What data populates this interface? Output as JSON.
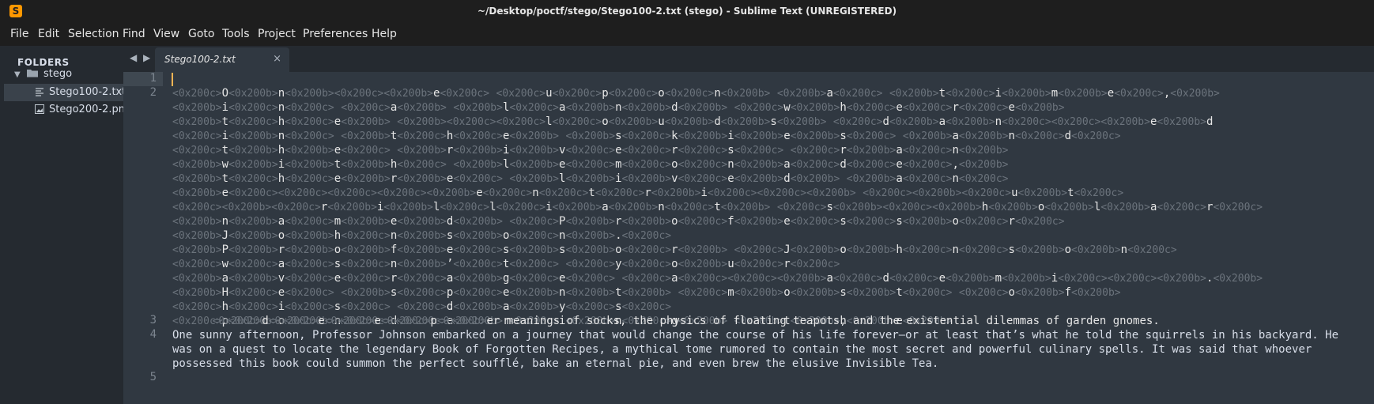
{
  "window": {
    "title": "~/Desktop/poctf/stego/Stego100-2.txt (stego) - Sublime Text (UNREGISTERED)",
    "app_icon": "S"
  },
  "menu": [
    "File",
    "Edit",
    "Selection",
    "Find",
    "View",
    "Goto",
    "Tools",
    "Project",
    "Preferences",
    "Help"
  ],
  "sidebar": {
    "header": "FOLDERS",
    "folder": "stego",
    "files": [
      "Stego100-2.txt",
      "Stego200-2.png"
    ]
  },
  "tab": {
    "label": "Stego100-2.txt",
    "close": "×"
  },
  "nav_arrows": "◀ ▶",
  "gutter": {
    "line_numbers": [
      "1",
      "2",
      "3",
      "4",
      "5"
    ]
  },
  "editor": {
    "zw_b": "<0x200b>",
    "zw_c": "<0x200c>",
    "hidden_rows": [
      "cOb|n|b|c|b|e|c| |c|u|c|p|c|o|c|n|b| |b|a|c| |b|t|c|i|b|m|b|e|c|,|b",
      "b|i|c|n|c| |c|a|b| |b|l|c|a|b|n|b|d|b| |c|w|b|h|c|e|c|r|c|e|b",
      "b|t|c|h|c|e|b| |b|c|c|l|c|o|b|u|b|d|b|s|b| |c|d|b|a|b|n|c|c|b|e|b|d",
      "c|i|b|n|c| |b|t|c|h|c|e|b| |b|s|c|k|b|i|b|e|b|s|c| |b|a|b|n|c|d|c",
      "c|t|b|h|b|e|c| |b|r|b|i|b|v|c|e|c|r|c|s|c| |c|r|b|a|c|n|b",
      "b|w|b|i|b|t|b|h|c| |b|l|b|e|c|m|c|o|c|n|b|a|c|d|c|e|c|,|b",
      "b|t|c|h|c|e|b|r|b|e|c| |b|l|b|i|b|v|c|e|b|d|b| |b|a|c|n|c",
      "b|e|c|c|c|c|b|e|c|n|c|t|c|r|b|i|c|c|b| |c|b|c|u|b|t|c",
      "c|b|c|r|b|i|b|l|c|l|c|i|b|a|b|n|c|t|b| |c|s|b|c|b|h|b|o|b|l|b|a|c|r|c",
      "b|n|b|a|c|m|b|e|b|d|b| |c|P|b|r|b|o|c|f|b|e|c|s|c|s|b|o|c|r|c",
      "b|J|b|o|b|h|c|n|b|s|b|o|c|n|b|.|c",
      "b|P|b|r|b|o|b|f|b|e|c|s|b|s|b|o|c|r|b| |c|J|b|o|b|h|c|n|c|s|b|o|b|n|c",
      "c|w|c|a|c|s|c|n|b|’|c|t|c| |c|y|c|o|b|u|c|r|c",
      "b|a|b|v|c|e|c|r|c|a|b|g|c|e|c| |c|a|c|c|b|a|c|d|c|e|b|m|b|i|c|c|b|.|b",
      "b|H|c|e|c| |b|s|c|p|c|e|b|n|b|t|b| |c|m|b|o|b|s|b|t|c| |c|o|b|f|b",
      "c|h|c|i|c|s|c| |c|d|b|a|b|y|c|s|c",
      "c|p|b|o|b|n|c|d|c|e|b|r|c|i|b|n|c|g|b| |b|t|b|h|b|e|b",
      "b|d|b|e|b|e|c|p|b"
    ],
    "line2_tail": "er meanings of socks, the physics of floating teapots, and the existential dilemmas of garden gnomes.",
    "line4": "One sunny afternoon, Professor Johnson embarked on a journey that would change the course of his life forever—or at least that’s what he told the squirrels in his backyard. He was on a quest to locate the legendary Book of Forgotten Recipes, a mythical tome rumored to contain the most secret and powerful culinary spells. It was said that whoever possessed this book could summon the perfect soufflé, bake an eternal pie, and even brew the elusive Invisible Tea."
  }
}
